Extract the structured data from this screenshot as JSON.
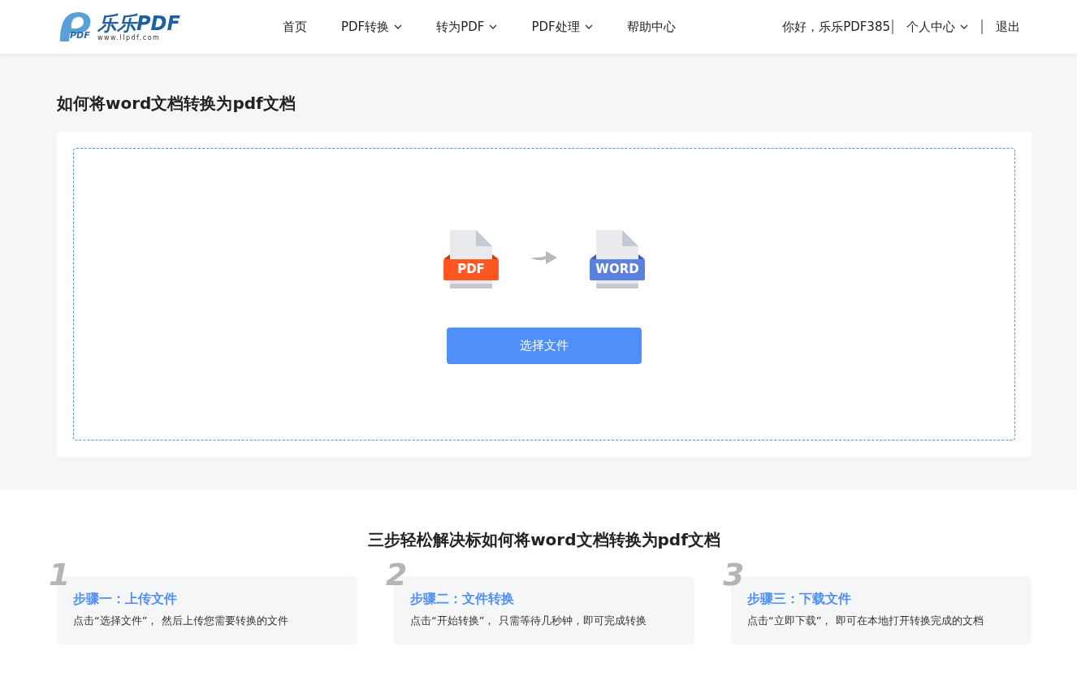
{
  "header": {
    "logo": {
      "mark": "PDF",
      "name": "乐乐PDF",
      "url": "www.llpdf.com"
    },
    "nav": [
      {
        "label": "首页",
        "dropdown": false
      },
      {
        "label": "PDF转换",
        "dropdown": true
      },
      {
        "label": "转为PDF",
        "dropdown": true
      },
      {
        "label": "PDF处理",
        "dropdown": true
      },
      {
        "label": "帮助中心",
        "dropdown": false
      }
    ],
    "greeting": "你好，乐乐PDF385",
    "user_menu": {
      "label": "个人中心",
      "dropdown": true
    },
    "logout": "退出"
  },
  "page_title": "如何将word文档转换为pdf文档",
  "upload": {
    "from_label": "PDF",
    "to_label": "WORD",
    "button": "选择文件"
  },
  "steps_title": "三步轻松解决标如何将word文档转换为pdf文档",
  "steps": [
    {
      "number": "1",
      "title": "步骤一：上传文件",
      "text": "点击“选择文件”， 然后上传您需要转换的文件"
    },
    {
      "number": "2",
      "title": "步骤二：文件转换",
      "text": "点击“开始转换”， 只需等待几秒钟，即可完成转换"
    },
    {
      "number": "3",
      "title": "步骤三：下载文件",
      "text": "点击“立即下载”， 即可在本地打开转换完成的文档"
    }
  ]
}
